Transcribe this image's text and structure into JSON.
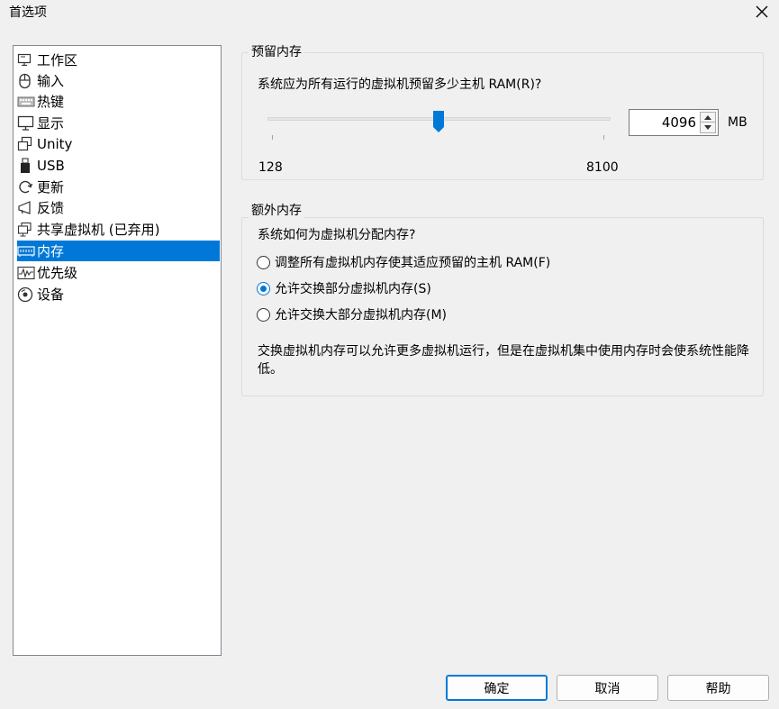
{
  "window": {
    "title": "首选项"
  },
  "sidebar": {
    "items": [
      {
        "label": "工作区",
        "icon": "workspace-icon"
      },
      {
        "label": "输入",
        "icon": "mouse-icon"
      },
      {
        "label": "热键",
        "icon": "keyboard-icon"
      },
      {
        "label": "显示",
        "icon": "monitor-icon"
      },
      {
        "label": "Unity",
        "icon": "unity-windows-icon"
      },
      {
        "label": "USB",
        "icon": "usb-icon"
      },
      {
        "label": "更新",
        "icon": "refresh-icon"
      },
      {
        "label": "反馈",
        "icon": "megaphone-icon"
      },
      {
        "label": "共享虚拟机 (已弃用)",
        "icon": "shared-vm-icon"
      },
      {
        "label": "内存",
        "icon": "memory-icon"
      },
      {
        "label": "优先级",
        "icon": "priority-chart-icon"
      },
      {
        "label": "设备",
        "icon": "device-disc-icon"
      }
    ],
    "selected": "内存"
  },
  "reserved_memory": {
    "group_title": "预留内存",
    "question": "系统应为所有运行的虚拟机预留多少主机 RAM(R)?",
    "min_label": "128",
    "max_label": "8100",
    "min": 128,
    "max": 8100,
    "value": "4096",
    "unit": "MB"
  },
  "additional_memory": {
    "group_title": "额外内存",
    "question": "系统如何为虚拟机分配内存?",
    "options": [
      {
        "label": "调整所有虚拟机内存使其适应预留的主机 RAM(F)",
        "checked": false
      },
      {
        "label": "允许交换部分虚拟机内存(S)",
        "checked": true
      },
      {
        "label": "允许交换大部分虚拟机内存(M)",
        "checked": false
      }
    ],
    "note": "交换虚拟机内存可以允许更多虚拟机运行，但是在虚拟机集中使用内存时会使系统性能降低。"
  },
  "buttons": {
    "ok": "确定",
    "cancel": "取消",
    "help": "帮助"
  },
  "colors": {
    "accent": "#0078d7",
    "background": "#f0f0f0"
  }
}
